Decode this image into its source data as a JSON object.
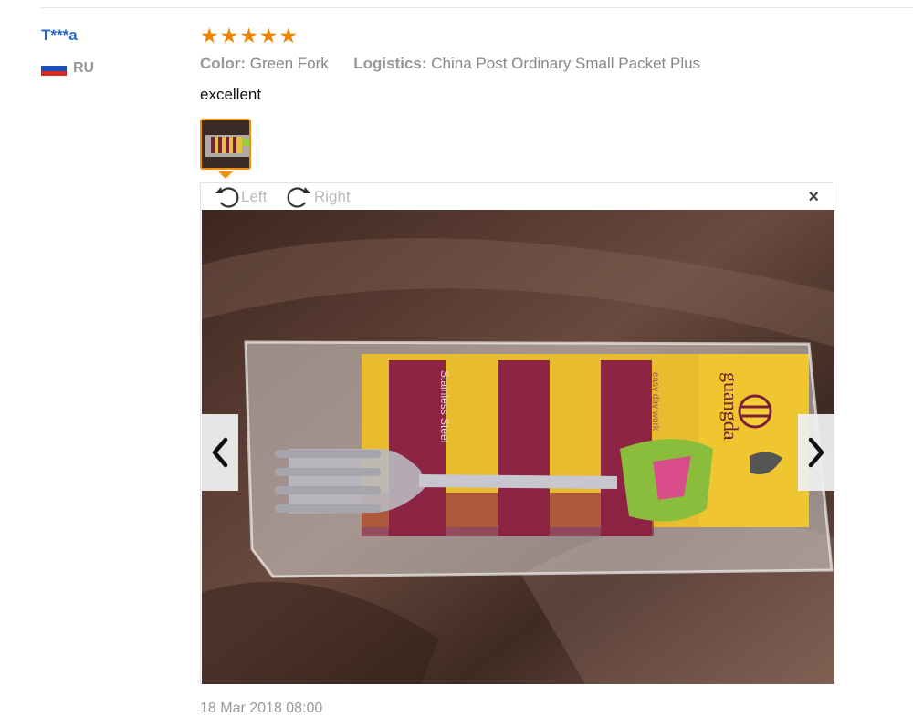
{
  "review": {
    "user_name": "T***a",
    "country_code": "RU",
    "flag_colors": [
      "#ffffff",
      "#1e4fbf",
      "#d52b1e"
    ],
    "rating": 5,
    "rating_max": 5,
    "star_color": "#f08400",
    "attributes": [
      {
        "label": "Color:",
        "value": "Green Fork"
      },
      {
        "label": "Logistics:",
        "value": "China Post Ordinary Small Packet Plus"
      }
    ],
    "text": "excellent",
    "date": "18 Mar 2018 08:00"
  },
  "viewer": {
    "rotate_left_label": "Left",
    "rotate_right_label": "Right",
    "close_symbol": "×",
    "prev_icon": "chevron-left-icon",
    "next_icon": "chevron-right-icon",
    "package_print": {
      "brand": "guangda",
      "line1": "Stainless Steel",
      "line2": "easy day work"
    }
  },
  "colors": {
    "link": "#2668c6",
    "accent": "#f08400"
  }
}
